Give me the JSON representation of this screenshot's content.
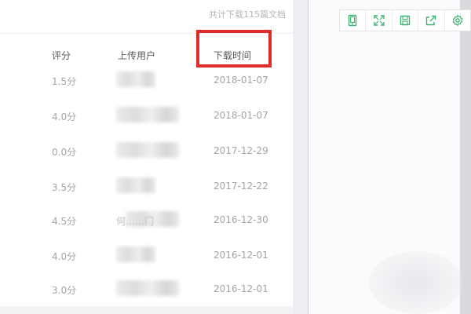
{
  "summary": "共计下载115篇文档",
  "columns": {
    "rating": "评分",
    "uploader": "上传用户",
    "download_time": "下载时间"
  },
  "rows": [
    {
      "rating": "1.5分",
      "uploader": "",
      "date": "2018-01-07"
    },
    {
      "rating": "4.0分",
      "uploader": "",
      "date": "2018-01-07"
    },
    {
      "rating": "0.0分",
      "uploader": "",
      "date": "2017-12-29"
    },
    {
      "rating": "3.5分",
      "uploader": "",
      "date": "2017-12-22"
    },
    {
      "rating": "4.5分",
      "uploader": "何……门",
      "date": "2016-12-30"
    },
    {
      "rating": "4.0分",
      "uploader": "",
      "date": "2016-12-01"
    },
    {
      "rating": "3.0分",
      "uploader": "",
      "date": "2016-12-01"
    }
  ],
  "toolbar": {
    "icons": [
      "tablet-icon",
      "fullscreen-icon",
      "save-icon",
      "share-icon",
      "settings-icon"
    ],
    "icon_color": "#3cb371"
  },
  "highlight_color": "#e02b2b"
}
